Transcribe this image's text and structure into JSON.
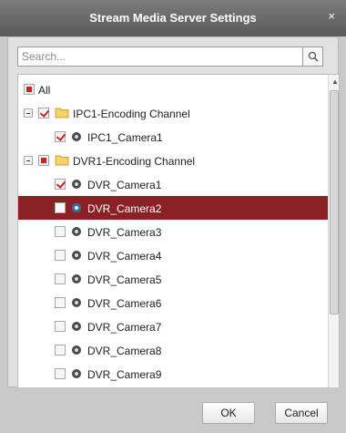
{
  "window": {
    "title": "Stream Media Server Settings",
    "close_glyph": "×"
  },
  "search": {
    "placeholder": "Search...",
    "value": ""
  },
  "tree": {
    "all_label": "All",
    "groups": [
      {
        "label": "IPC1-Encoding Channel",
        "state": "checked",
        "items": [
          {
            "label": "IPC1_Camera1",
            "checked": true
          }
        ]
      },
      {
        "label": "DVR1-Encoding Channel",
        "state": "partial",
        "items": [
          {
            "label": "DVR_Camera1",
            "checked": true
          },
          {
            "label": "DVR_Camera2",
            "checked": false,
            "selected": true
          },
          {
            "label": "DVR_Camera3",
            "checked": false
          },
          {
            "label": "DVR_Camera4",
            "checked": false
          },
          {
            "label": "DVR_Camera5",
            "checked": false
          },
          {
            "label": "DVR_Camera6",
            "checked": false
          },
          {
            "label": "DVR_Camera7",
            "checked": false
          },
          {
            "label": "DVR_Camera8",
            "checked": false
          },
          {
            "label": "DVR_Camera9",
            "checked": false
          }
        ]
      }
    ]
  },
  "buttons": {
    "ok": "OK",
    "cancel": "Cancel"
  },
  "colors": {
    "selection": "#8a2125",
    "check": "#cc2222"
  }
}
